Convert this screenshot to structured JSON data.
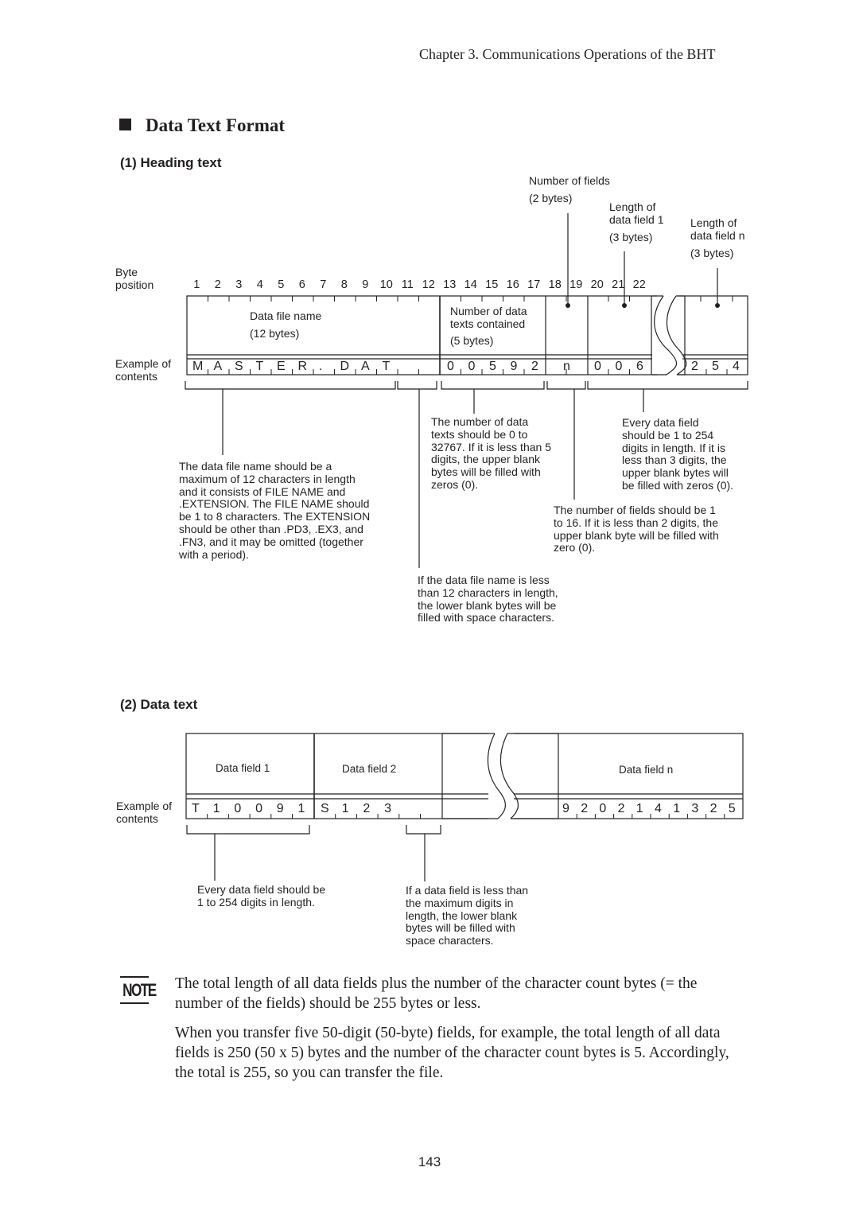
{
  "page": {
    "running_header": "Chapter 3.  Communications Operations of the BHT",
    "section_title": "Data Text Format",
    "page_number": "143"
  },
  "heading_text": {
    "subheading": "(1)  Heading text",
    "row_labels": {
      "byte_position_1": "Byte",
      "byte_position_2": "position",
      "example_1": "Example of",
      "example_2": "contents"
    },
    "byte_positions": [
      "1",
      "2",
      "3",
      "4",
      "5",
      "6",
      "7",
      "8",
      "9",
      "10",
      "11",
      "12",
      "13",
      "14",
      "15",
      "16",
      "17",
      "18",
      "19",
      "20",
      "21",
      "22"
    ],
    "fields": {
      "file_name": {
        "label": "Data file name",
        "bytes": "(12 bytes)",
        "example": [
          "M",
          "A",
          "S",
          "T",
          "E",
          "R",
          ".",
          "D",
          "A",
          "T",
          " ",
          " "
        ]
      },
      "data_count": {
        "label_1": "Number of data",
        "label_2": "texts contained",
        "bytes": "(5 bytes)",
        "example": [
          "0",
          "0",
          "5",
          "9",
          "2"
        ]
      },
      "num_fields": {
        "label": "Number of fields",
        "bytes": "(2 bytes)",
        "example": "n"
      },
      "len_field_1": {
        "label_1": "Length of",
        "label_2": "data field 1",
        "bytes": "(3 bytes)",
        "example": [
          "0",
          "0",
          "6"
        ]
      },
      "len_field_n": {
        "label_1": "Length of",
        "label_2": "data field n",
        "bytes": "(3 bytes)",
        "example": [
          "2",
          "5",
          "4"
        ]
      }
    },
    "notes": {
      "file_name_rule": [
        "The data file name should be a",
        "maximum of 12 characters in length",
        "and it consists of FILE NAME and",
        ".EXTENSION.  The FILE NAME should",
        "be 1 to 8 characters.  The EXTENSION",
        "should be other than .PD3, .EX3, and",
        ".FN3, and it may be omitted (together",
        "with a period)."
      ],
      "file_name_padding": [
        "If the data file name is less",
        "than 12 characters in length,",
        "the lower blank bytes will be",
        "filled with space characters."
      ],
      "data_count_rule": [
        "The number of data",
        "texts should be 0 to",
        "32767.  If it is less than 5",
        "digits, the upper blank",
        "bytes will be filled with",
        "zeros (0)."
      ],
      "num_fields_rule": [
        "The number of fields should be 1",
        "to 16.  If it is less than 2 digits, the",
        "upper blank byte will be filled with",
        "zero (0)."
      ],
      "field_length_rule": [
        "Every data field",
        "should be 1 to 254",
        "digits in length.  If it is",
        "less than 3 digits, the",
        "upper blank bytes will",
        "be filled with zeros (0)."
      ]
    }
  },
  "data_text": {
    "subheading": "(2)  Data text",
    "row_labels": {
      "example_1": "Example of",
      "example_2": "contents"
    },
    "fields": [
      {
        "label": "Data field 1",
        "example": [
          "T",
          "1",
          "0",
          "0",
          "9",
          "1"
        ]
      },
      {
        "label": "Data field 2",
        "example": [
          "S",
          "1",
          "2",
          "3",
          " ",
          " "
        ]
      },
      {
        "label": "Data field n",
        "example": [
          "9",
          "2",
          "0",
          "2",
          "1",
          "4",
          "1",
          "3",
          "2",
          "5"
        ]
      }
    ],
    "notes": {
      "length_rule": [
        "Every data field should be",
        "1 to 254 digits in length."
      ],
      "padding_rule": [
        "If a data field is less than",
        "the maximum digits in",
        "length, the lower blank",
        "bytes will be filled with",
        "space characters."
      ]
    }
  },
  "note": {
    "icon": "note-icon",
    "icon_text": "NOTE",
    "paragraph_1": "The total length of all data fields plus the number of the character count bytes (= the number of the fields) should be 255 bytes or less.",
    "paragraph_2": "When you transfer five 50-digit (50-byte) fields, for example, the total length of all data fields is 250 (50 x 5) bytes and the number of the character count bytes is 5. Accordingly, the total is 255, so you can transfer the file."
  }
}
